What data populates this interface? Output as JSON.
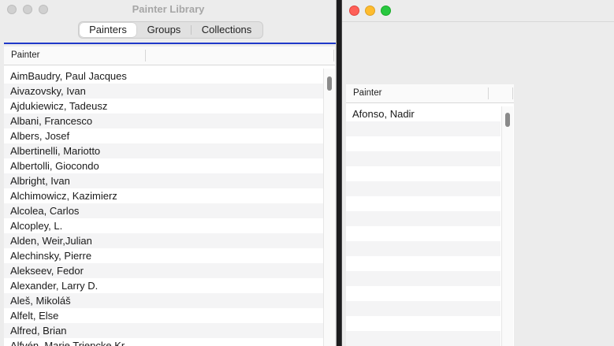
{
  "left_window": {
    "title": "Painter Library",
    "tabs": [
      {
        "label": "Painters",
        "active": true
      },
      {
        "label": "Groups",
        "active": false
      },
      {
        "label": "Collections",
        "active": false
      }
    ],
    "table": {
      "column_header": "Painter",
      "rows": [
        "AimBaudry, Paul Jacques",
        "Aivazovsky, Ivan",
        "Ajdukiewicz, Tadeusz",
        "Albani, Francesco",
        "Albers, Josef",
        "Albertinelli, Mariotto",
        "Albertolli, Giocondo",
        "Albright, Ivan",
        "Alchimowicz, Kazimierz",
        "Alcolea, Carlos",
        "Alcopley, L.",
        "Alden, Weir,Julian",
        "Alechinsky, Pierre",
        "Alekseev, Fedor",
        "Alexander, Larry D.",
        "Aleš, Mikoláš",
        "Alfelt, Else",
        "Alfred, Brian",
        "Alfvén, Marie Triepcke Kr..."
      ]
    }
  },
  "right_window": {
    "table": {
      "column_header": "Painter",
      "rows": [
        "Afonso, Nadir"
      ],
      "empty_rows": 15
    }
  },
  "colors": {
    "accent_line": "#1f38c9",
    "close": "#fe5f57",
    "minimize": "#febc2e",
    "maximize": "#28c840"
  }
}
